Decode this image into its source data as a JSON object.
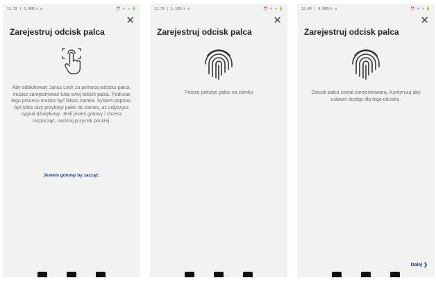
{
  "screens": [
    {
      "status_time": "12:39 | 0,9KB/s ✉",
      "status_icons": "⏰ ᯤ ✈ 🔋",
      "close_glyph": "✕",
      "title": "Zarejestruj odcisk palca",
      "icon": "finger-touch-icon",
      "body": "Aby odblokować Janus Lock za pomocą odcisku palca, musisz zarejestrować tutaj swój odcisk palca. Podczas tego procesu musisz być blisko zamka. System poprosi, byś kilka razy przyłożył palec do zamka, aż usłyszysz sygnał dźwiękowy. Jeśli jesteś gotowy i chcesz rozpocząć, naciśnij przycisk poniżej.",
      "link": "Jestem gotowy by zacząć."
    },
    {
      "status_time": "12:39 | 1,1KB/s ✉",
      "status_icons": "⏰ ᯤ ✈ 🔋",
      "close_glyph": "✕",
      "title": "Zarejestruj odcisk palca",
      "icon": "fingerprint-icon",
      "body": "Proszę położyć palec na zamku"
    },
    {
      "status_time": "12:40 | 0,9KB/s ✉",
      "status_icons": "⏰ ᯤ ✈ 🔋",
      "close_glyph": "✕",
      "title": "Zarejestruj odcisk palca",
      "icon": "fingerprint-icon",
      "body": "Odcisk palca został zarejestrowany. Kontynuuj aby ustawić dostęp dla tego odcisku.",
      "next": "Dalej  ❯"
    }
  ],
  "colors": {
    "screen_bg": "#f2f2f2",
    "title": "#222222",
    "body": "#6a6a6a",
    "accent": "#1f3f8f"
  }
}
